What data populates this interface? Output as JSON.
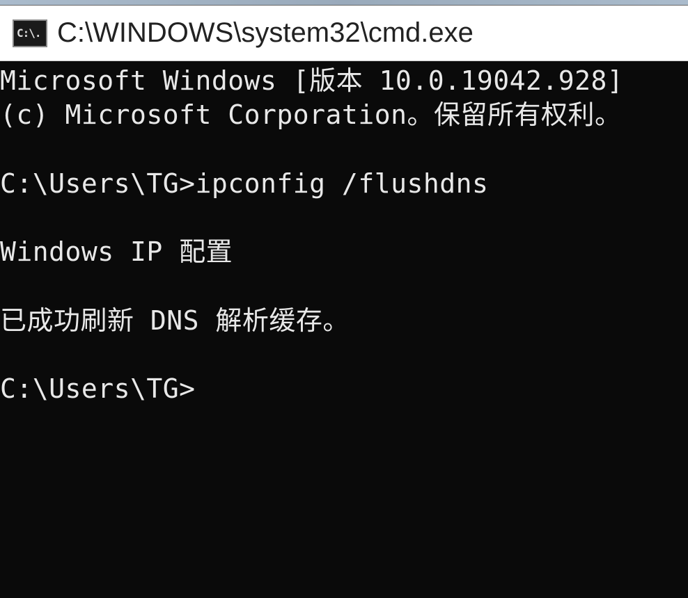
{
  "window": {
    "title": "C:\\WINDOWS\\system32\\cmd.exe",
    "icon_label": "C:\\."
  },
  "terminal": {
    "lines": [
      "Microsoft Windows [版本 10.0.19042.928]",
      "(c) Microsoft Corporation。保留所有权利。",
      "",
      "C:\\Users\\TG>ipconfig /flushdns",
      "",
      "Windows IP 配置",
      "",
      "已成功刷新 DNS 解析缓存。",
      "",
      "C:\\Users\\TG>"
    ]
  }
}
